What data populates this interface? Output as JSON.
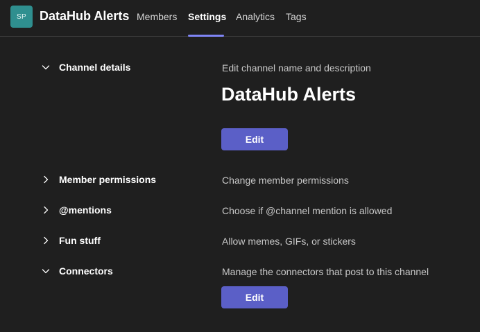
{
  "header": {
    "avatar_initials": "SP",
    "team_name": "DataHub Alerts",
    "tabs": [
      {
        "label": "Members"
      },
      {
        "label": "Settings"
      },
      {
        "label": "Analytics"
      },
      {
        "label": "Tags"
      }
    ],
    "active_tab": "Settings"
  },
  "settings": {
    "channel_details": {
      "label": "Channel details",
      "expanded": true,
      "description": "Edit channel name and description",
      "channel_name": "DataHub Alerts",
      "button_label": "Edit"
    },
    "member_permissions": {
      "label": "Member permissions",
      "expanded": false,
      "description": "Change member permissions"
    },
    "mentions": {
      "label": "@mentions",
      "expanded": false,
      "description": "Choose if @channel mention is allowed"
    },
    "fun_stuff": {
      "label": "Fun stuff",
      "expanded": false,
      "description": "Allow memes, GIFs, or stickers"
    },
    "connectors": {
      "label": "Connectors",
      "expanded": true,
      "description": "Manage the connectors that post to this channel",
      "button_label": "Edit"
    }
  },
  "colors": {
    "background": "#1f1f1f",
    "accent": "#5b5fc7",
    "tab_underline": "#7f85f5",
    "avatar": "#2f8f8f"
  }
}
